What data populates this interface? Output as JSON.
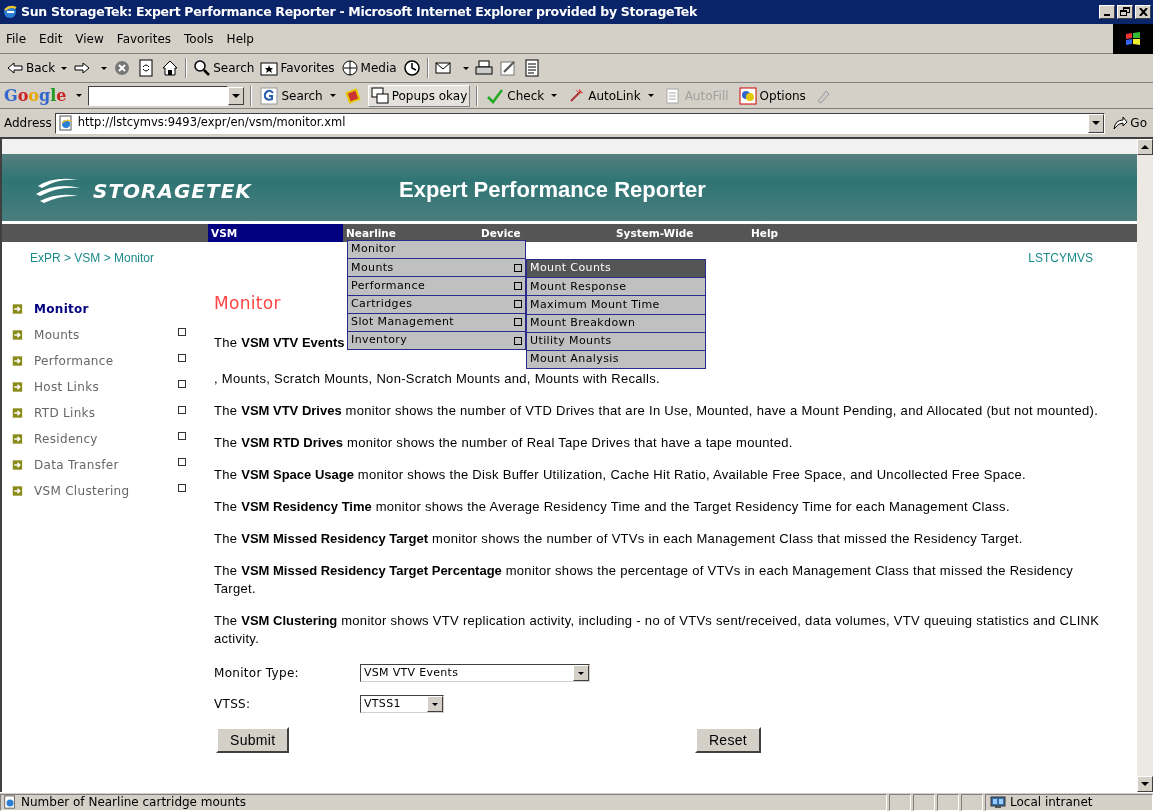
{
  "window": {
    "title": "Sun StorageTek: Expert Performance Reporter - Microsoft Internet Explorer provided by StorageTek"
  },
  "menu_bar": [
    "File",
    "Edit",
    "View",
    "Favorites",
    "Tools",
    "Help"
  ],
  "toolbar": [
    {
      "label": "Back"
    },
    {
      "label": "Search"
    },
    {
      "label": "Favorites"
    },
    {
      "label": "Media"
    }
  ],
  "google_bar": {
    "logo": "Google",
    "buttons": [
      {
        "label": "Search",
        "dropdown": true,
        "disabled": false
      },
      {
        "label": "Popups okay",
        "dropdown": false,
        "disabled": false
      },
      {
        "label": "Check",
        "dropdown": true,
        "disabled": false
      },
      {
        "label": "AutoLink",
        "dropdown": true,
        "disabled": false
      },
      {
        "label": "AutoFill",
        "dropdown": false,
        "disabled": true
      },
      {
        "label": "Options",
        "dropdown": false,
        "disabled": false
      }
    ]
  },
  "address_bar": {
    "label": "Address",
    "url": "http://lstcymvs:9493/expr/en/vsm/monitor.xml",
    "go": "Go"
  },
  "banner": {
    "logo": "STORAGETEK",
    "title": "Expert Performance Reporter"
  },
  "nav": [
    {
      "label": "VSM",
      "selected": true
    },
    {
      "label": "Nearline",
      "selected": false
    },
    {
      "label": "Device",
      "selected": false
    },
    {
      "label": "System-Wide",
      "selected": false
    },
    {
      "label": "Help",
      "selected": false
    }
  ],
  "breadcrumb": "ExPR > VSM > Monitor",
  "host": "LSTCYMVS",
  "sidebar": {
    "items": [
      {
        "label": "Monitor",
        "selected": true,
        "expandable": false
      },
      {
        "label": "Mounts",
        "selected": false,
        "expandable": true
      },
      {
        "label": "Performance",
        "selected": false,
        "expandable": true
      },
      {
        "label": "Host Links",
        "selected": false,
        "expandable": true
      },
      {
        "label": "RTD Links",
        "selected": false,
        "expandable": true
      },
      {
        "label": "Residency",
        "selected": false,
        "expandable": true
      },
      {
        "label": "Data Transfer",
        "selected": false,
        "expandable": true
      },
      {
        "label": "VSM Clustering",
        "selected": false,
        "expandable": true
      }
    ]
  },
  "heading": "Monitor",
  "first_paragraph": {
    "start": "The **VSM VTV Events**",
    "end": ", Mounts, Scratch Mounts, Non-Scratch Mounts and, Mounts with Recalls."
  },
  "paragraphs": [
    "The **VSM VTV Drives** monitor shows the number of VTD Drives that are In Use, Mounted, have a Mount Pending, and Allocated (but not mounted).",
    "The **VSM RTD Drives** monitor shows the number of Real Tape Drives that have a tape mounted.",
    "The **VSM Space Usage** monitor shows the Disk Buffer Utilization, Cache Hit Ratio, Available Free Space, and Uncollected Free Space.",
    "The **VSM Residency Time** monitor shows the Average Residency Time and the Target Residency Time for each Management Class.",
    "The **VSM Missed Residency Target** monitor shows the number of VTVs in each Management Class that missed the Residency Target.",
    "The **VSM Missed Residency Target Percentage** monitor shows the percentage of VTVs in each Management Class that missed the Residency Target.",
    "The **VSM Clustering** monitor shows VTV replication activity, including - no of VTVs sent/received, data volumes, VTV queuing statistics and CLINK activity."
  ],
  "form": {
    "fields": [
      {
        "label": "Monitor Type:",
        "value": "VSM VTV Events"
      },
      {
        "label": "VTSS:",
        "value": "VTSS1"
      }
    ],
    "buttons": [
      "Submit",
      "Reset"
    ]
  },
  "nearline_menu": {
    "items": [
      {
        "label": "Monitor",
        "submenu": false
      },
      {
        "label": "Mounts",
        "submenu": true
      },
      {
        "label": "Performance",
        "submenu": true
      },
      {
        "label": "Cartridges",
        "submenu": true
      },
      {
        "label": "Slot Management",
        "submenu": true
      },
      {
        "label": "Inventory",
        "submenu": true
      }
    ]
  },
  "mounts_submenu": {
    "items": [
      {
        "label": "Mount Counts",
        "selected": true
      },
      {
        "label": "Mount Response",
        "selected": false
      },
      {
        "label": "Maximum Mount Time",
        "selected": false
      },
      {
        "label": "Mount Breakdown",
        "selected": false
      },
      {
        "label": "Utility Mounts",
        "selected": false
      },
      {
        "label": "Mount Analysis",
        "selected": false
      }
    ]
  },
  "status_bar": {
    "text": "Number of Nearline cartridge mounts",
    "zone": "Local intranet"
  }
}
